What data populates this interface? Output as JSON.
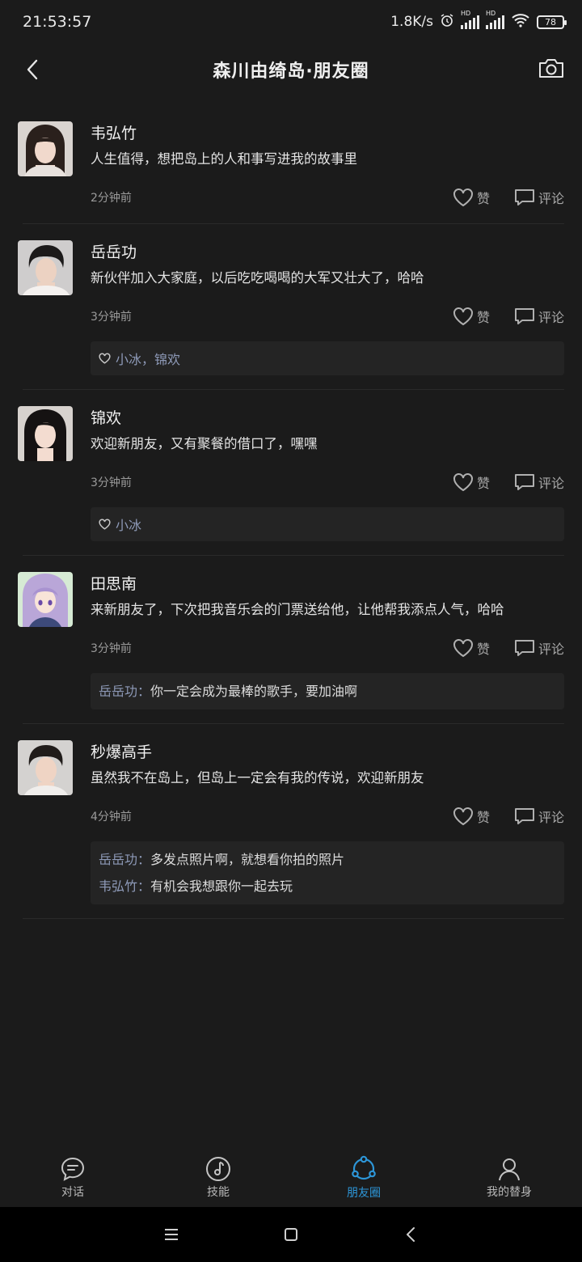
{
  "status": {
    "time": "21:53:57",
    "speed": "1.8K/s",
    "hd1": "HD",
    "hd2": "HD",
    "battery": "78"
  },
  "header": {
    "title": "森川由绮岛·朋友圈",
    "back_icon": "chevron-left-icon",
    "camera_icon": "camera-icon"
  },
  "labels": {
    "like": "赞",
    "comment": "评论",
    "colon": "："
  },
  "posts": [
    {
      "author": "韦弘竹",
      "content": "人生值得，想把岛上的人和事写进我的故事里",
      "time": "2分钟前",
      "likes": "",
      "comments": []
    },
    {
      "author": "岳岳功",
      "content": "新伙伴加入大家庭，以后吃吃喝喝的大军又壮大了，哈哈",
      "time": "3分钟前",
      "likes": "小冰，锦欢",
      "comments": []
    },
    {
      "author": "锦欢",
      "content": "欢迎新朋友，又有聚餐的借口了，嘿嘿",
      "time": "3分钟前",
      "likes": "小冰",
      "comments": []
    },
    {
      "author": "田思南",
      "content": "来新朋友了，下次把我音乐会的门票送给他，让他帮我添点人气，哈哈",
      "time": "3分钟前",
      "likes": "",
      "comments": [
        {
          "author": "岳岳功",
          "text": "你一定会成为最棒的歌手，要加油啊"
        }
      ]
    },
    {
      "author": "秒爆高手",
      "content": "虽然我不在岛上，但岛上一定会有我的传说，欢迎新朋友",
      "time": "4分钟前",
      "likes": "",
      "comments": [
        {
          "author": "岳岳功",
          "text": "多发点照片啊，就想看你拍的照片"
        },
        {
          "author": "韦弘竹",
          "text": "有机会我想跟你一起去玩"
        }
      ]
    }
  ],
  "tabs": [
    {
      "label": "对话",
      "icon": "chat-bubble-icon",
      "active": false
    },
    {
      "label": "技能",
      "icon": "music-note-icon",
      "active": false
    },
    {
      "label": "朋友圈",
      "icon": "moments-icon",
      "active": true
    },
    {
      "label": "我的替身",
      "icon": "person-icon",
      "active": false
    }
  ],
  "colors": {
    "background": "#1b1b1b",
    "accent": "#2d96d8",
    "name_link": "#8e9ab8",
    "panel": "#242424"
  }
}
